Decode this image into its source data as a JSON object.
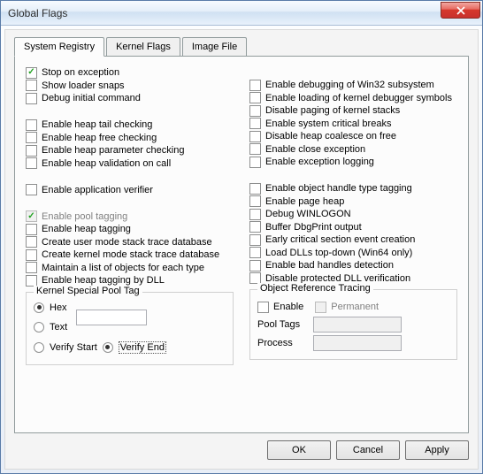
{
  "window": {
    "title": "Global Flags"
  },
  "tabs": [
    "System Registry",
    "Kernel Flags",
    "Image File"
  ],
  "left_checks": [
    {
      "label": "Stop on exception",
      "checked": true
    },
    {
      "label": "Show loader snaps",
      "checked": false
    },
    {
      "label": "Debug initial command",
      "checked": false
    }
  ],
  "left_checks2": [
    {
      "label": "Enable heap tail checking",
      "checked": false
    },
    {
      "label": "Enable heap free checking",
      "checked": false
    },
    {
      "label": "Enable heap parameter checking",
      "checked": false
    },
    {
      "label": "Enable heap validation on call",
      "checked": false
    }
  ],
  "left_checks3": [
    {
      "label": "Enable application verifier",
      "checked": false
    }
  ],
  "left_checks4": [
    {
      "label": "Enable pool tagging",
      "checked": true,
      "disabled": true
    },
    {
      "label": "Enable heap tagging",
      "checked": false
    },
    {
      "label": "Create user mode stack trace database",
      "checked": false
    },
    {
      "label": "Create kernel mode stack trace database",
      "checked": false
    },
    {
      "label": "Maintain a list of objects for each type",
      "checked": false
    },
    {
      "label": "Enable heap tagging by DLL",
      "checked": false
    }
  ],
  "right_checks": [
    {
      "label": "Enable debugging of Win32 subsystem",
      "checked": false
    },
    {
      "label": "Enable loading of kernel debugger symbols",
      "checked": false
    },
    {
      "label": "Disable paging of kernel stacks",
      "checked": false
    },
    {
      "label": "Enable system critical breaks",
      "checked": false
    },
    {
      "label": "Disable heap coalesce on free",
      "checked": false
    },
    {
      "label": "Enable close exception",
      "checked": false
    },
    {
      "label": "Enable exception logging",
      "checked": false
    }
  ],
  "right_checks2": [
    {
      "label": "Enable object handle type tagging",
      "checked": false
    },
    {
      "label": "Enable page heap",
      "checked": false
    },
    {
      "label": "Debug WINLOGON",
      "checked": false
    },
    {
      "label": "Buffer DbgPrint output",
      "checked": false
    },
    {
      "label": "Early critical section event creation",
      "checked": false
    },
    {
      "label": "Load DLLs top-down (Win64 only)",
      "checked": false
    },
    {
      "label": "Enable bad handles detection",
      "checked": false
    },
    {
      "label": "Disable protected DLL verification",
      "checked": false
    }
  ],
  "kspt": {
    "title": "Kernel Special Pool Tag",
    "hex": "Hex",
    "text": "Text",
    "verify_start": "Verify Start",
    "verify_end": "Verify End",
    "input_value": ""
  },
  "ort": {
    "title": "Object Reference Tracing",
    "enable": "Enable",
    "permanent": "Permanent",
    "pool_tags_label": "Pool Tags",
    "process_label": "Process",
    "pool_tags_value": "",
    "process_value": ""
  },
  "buttons": {
    "ok": "OK",
    "cancel": "Cancel",
    "apply": "Apply"
  }
}
